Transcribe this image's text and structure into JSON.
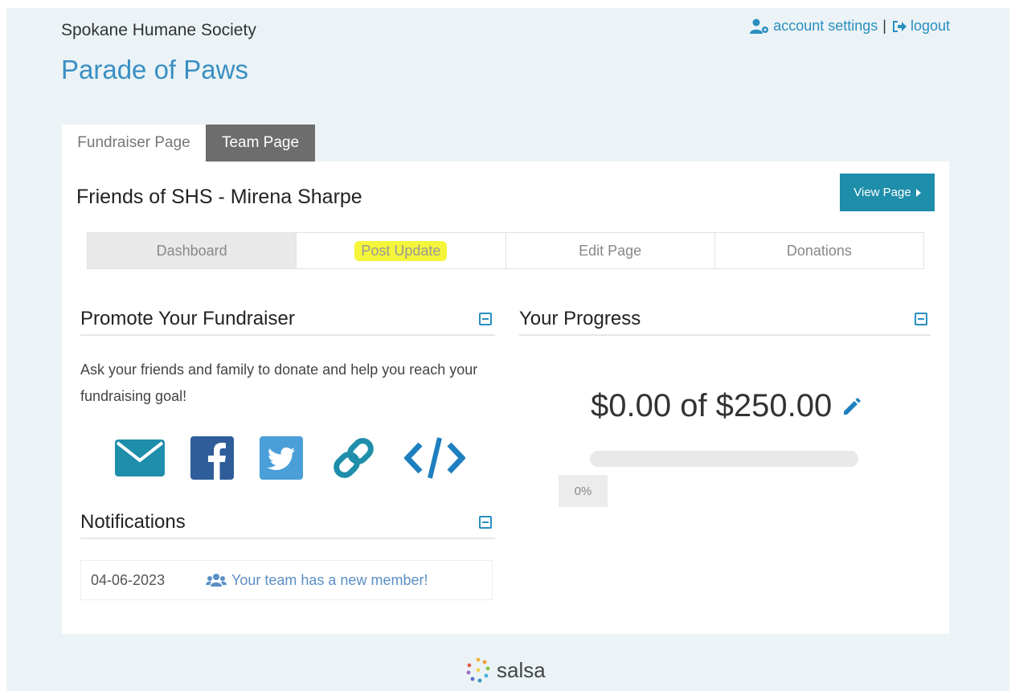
{
  "header": {
    "org_name": "Spokane Humane Society",
    "account_settings": "account settings",
    "separator": "|",
    "logout": "logout",
    "campaign_title": "Parade of Paws"
  },
  "tabs": [
    {
      "label": "Fundraiser Page",
      "active": true
    },
    {
      "label": "Team Page",
      "active": false
    }
  ],
  "panel": {
    "fundraiser_name": "Friends of SHS - Mirena Sharpe",
    "view_page": "View Page",
    "subnav": [
      {
        "label": "Dashboard",
        "active": true
      },
      {
        "label": "Post Update",
        "highlighted": true
      },
      {
        "label": "Edit Page"
      },
      {
        "label": "Donations"
      }
    ]
  },
  "promote": {
    "title": "Promote Your Fundraiser",
    "text": "Ask your friends and family to donate and help you reach your fundraising goal!",
    "icons": [
      "envelope-icon",
      "facebook-icon",
      "twitter-icon",
      "link-icon",
      "code-icon"
    ]
  },
  "progress": {
    "title": "Your Progress",
    "amount_text": "$0.00 of $250.00",
    "raised": 0.0,
    "goal": 250.0,
    "percent_label": "0%",
    "percent": 0
  },
  "notifications": {
    "title": "Notifications",
    "items": [
      {
        "date": "04-06-2023",
        "message": "Your team has a new member!"
      }
    ]
  },
  "footer": {
    "brand": "salsa"
  },
  "colors": {
    "accent": "#1e8eaa",
    "link": "#2a8fc0",
    "highlight": "#f5f53a",
    "page_bg": "#ebf3f6"
  }
}
